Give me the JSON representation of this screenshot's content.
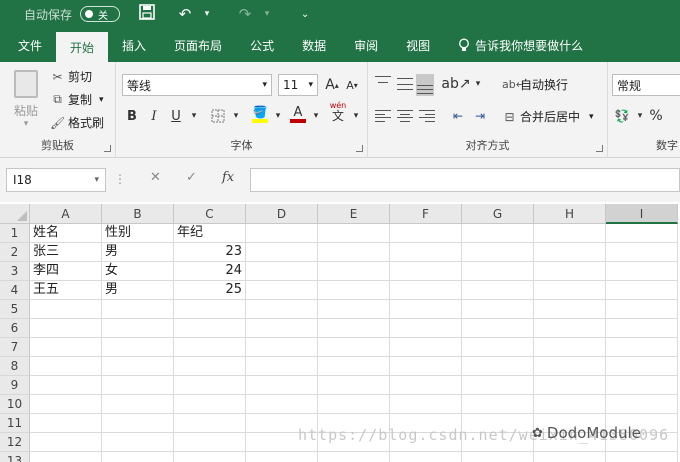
{
  "quick_access": {
    "autosave_label": "自动保存",
    "toggle_state": "关"
  },
  "tabs": [
    "文件",
    "开始",
    "插入",
    "页面布局",
    "公式",
    "数据",
    "审阅",
    "视图"
  ],
  "active_tab": "开始",
  "tell_me": "告诉我你想要做什么",
  "clipboard": {
    "paste": "粘贴",
    "cut": "剪切",
    "copy": "复制",
    "format_painter": "格式刷",
    "label": "剪贴板"
  },
  "font": {
    "name": "等线",
    "size": "11",
    "label": "字体",
    "bold": "B",
    "italic": "I",
    "underline": "U",
    "grow": "A",
    "shrink": "A",
    "wen": "wén",
    "wen_char": "文",
    "font_color_letter": "A"
  },
  "alignment": {
    "wrap": "自动换行",
    "merge": "合并后居中",
    "label": "对齐方式"
  },
  "number": {
    "format": "常规",
    "label": "数字",
    "percent": "%"
  },
  "formula_bar": {
    "name_box": "I18",
    "fx": "fx",
    "cancel": "✕",
    "enter": "✓",
    "value": ""
  },
  "columns": [
    "A",
    "B",
    "C",
    "D",
    "E",
    "F",
    "G",
    "H",
    "I"
  ],
  "selected_column": "I",
  "rows": [
    "1",
    "2",
    "3",
    "4",
    "5",
    "6",
    "7",
    "8",
    "9",
    "10",
    "11",
    "12",
    "13"
  ],
  "cells": {
    "A1": "姓名",
    "B1": "性别",
    "C1": "年纪",
    "A2": "张三",
    "B2": "男",
    "C2": "23",
    "A3": "李四",
    "B3": "女",
    "C3": "24",
    "A4": "王五",
    "B4": "男",
    "C4": "25"
  },
  "watermark": {
    "url": "https://blog.csdn.net/weixin_41380096",
    "brand": "DodoModule"
  }
}
